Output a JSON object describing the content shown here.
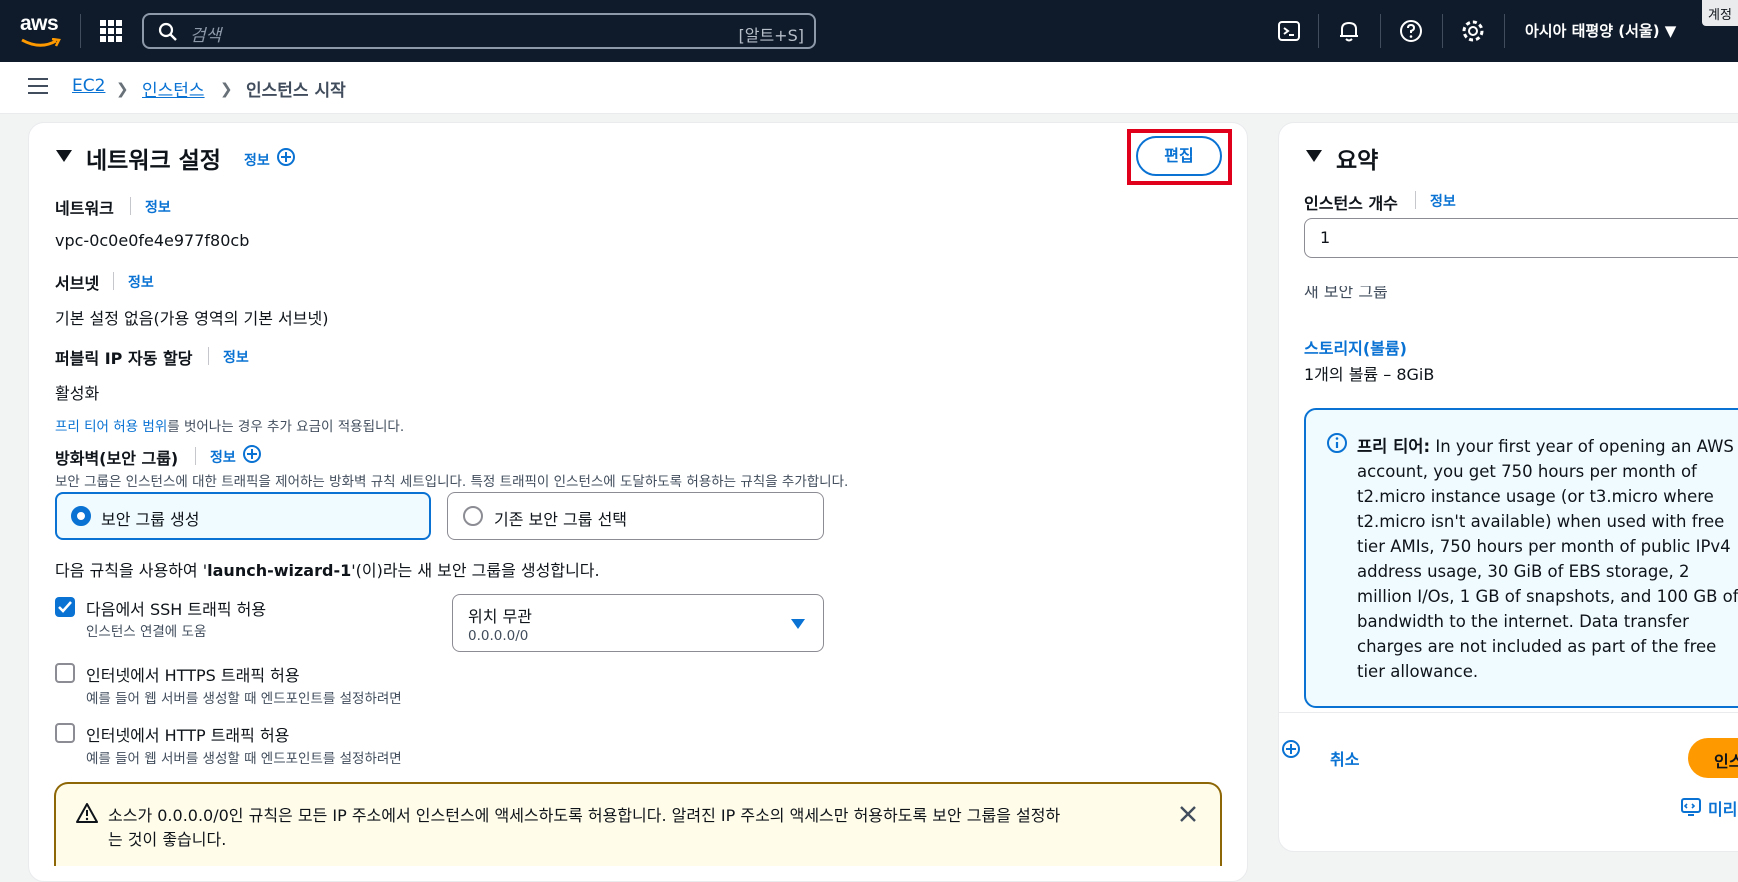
{
  "topnav": {
    "logo": "aws",
    "search_placeholder": "검색",
    "search_shortcut": "[알트+S]",
    "region": "아시아 태평양 (서울) ▼",
    "account": "계정",
    "icons": [
      "cloudshell-icon",
      "bell-icon",
      "help-icon",
      "gear-icon"
    ]
  },
  "breadcrumb": {
    "items": [
      "EC2",
      "인스턴스",
      "인스턴스 시작"
    ]
  },
  "network": {
    "title": "네트워크 설정",
    "info": "정보",
    "edit": "편집",
    "network_label": "네트워크",
    "network_value": "vpc-0c0e0fe4e977f80cb",
    "subnet_label": "서브넷",
    "subnet_value": "기본 설정 없음(가용 영역의 기본 서브넷)",
    "public_ip_label": "퍼블릭 IP 자동 할당",
    "public_ip_value": "활성화",
    "free_tier_link": "프리 티어 허용 범위",
    "free_tier_suffix": "를 벗어나는 경우 추가 요금이 적용됩니다.",
    "firewall_label": "방화벽(보안 그룹)",
    "firewall_desc": "보안 그룹은 인스턴스에 대한 트래픽을 제어하는 방화벽 규칙 세트입니다. 특정 트래픽이 인스턴스에 도달하도록 허용하는 규칙을 추가합니다.",
    "option_create": "보안 그룹 생성",
    "option_existing": "기존 보안 그룹 선택",
    "rule_prefix": "다음 규칙을 사용하여 '",
    "rule_name": "launch-wizard-1",
    "rule_suffix": "'(이)라는 새 보안 그룹을 생성합니다.",
    "ssh_label": "다음에서 SSH 트래픽 허용",
    "ssh_desc": "인스턴스 연결에 도움",
    "ssh_checked": true,
    "ssh_source": "위치 무관",
    "ssh_source_cidr": "0.0.0.0/0",
    "https_label": "인터넷에서 HTTPS 트래픽 허용",
    "https_desc": "예를 들어 웹 서버를 생성할 때 엔드포인트를 설정하려면",
    "https_checked": false,
    "http_label": "인터넷에서 HTTP 트래픽 허용",
    "http_desc": "예를 들어 웹 서버를 생성할 때 엔드포인트를 설정하려면",
    "http_checked": false,
    "warning_line1": "소스가 0.0.0.0/0인 규칙은 모든 IP 주소에서 인스턴스에 액세스하도록 허용합니다. 알려진 IP 주소의 액세스만 허용하도록 보안 그룹을 설정하",
    "warning_line2": "는 것이 좋습니다."
  },
  "summary": {
    "title": "요약",
    "count_label": "인스턴스 개수",
    "info": "정보",
    "count_value": "1",
    "sg_partial": "새 보안 그룹",
    "storage_link": "스토리지(볼륨)",
    "storage_value": "1개의 볼륨 – 8GiB",
    "free_tier_bold": "프리 티어:",
    "free_tier_text": " In your first year of opening an AWS account, you get 750 hours per month of t2.micro instance usage (or t3.micro where t2.micro isn't available) when used with free tier AMIs, 750 hours per month of public IPv4 address usage, 30 GiB of EBS storage, 2 million I/Os, 1 GB of snapshots, and 100 GB of bandwidth to the internet. Data transfer charges are not included as part of the free tier allowance.",
    "cancel": "취소",
    "launch_partial": "인스",
    "preview_partial": "미리"
  },
  "colors": {
    "link": "#0972d3",
    "nav_bg": "#0f1b2a",
    "highlight": "#e0001b",
    "primary_button": "#ff9900"
  }
}
